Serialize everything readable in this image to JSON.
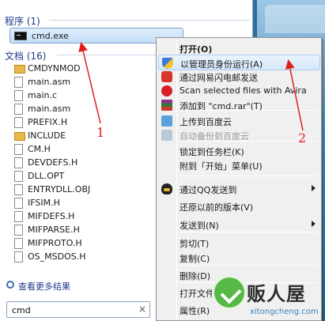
{
  "start_menu": {
    "programs_header": "程序 (1)",
    "program_item": "cmd.exe",
    "documents_header": "文档 (16)",
    "documents": [
      {
        "name": "CMDYNMOD",
        "type": "folder"
      },
      {
        "name": "main.asm",
        "type": "file"
      },
      {
        "name": "main.c",
        "type": "file"
      },
      {
        "name": "main.asm",
        "type": "file"
      },
      {
        "name": "PREFIX.H",
        "type": "file"
      },
      {
        "name": "INCLUDE",
        "type": "folder"
      },
      {
        "name": "CM.H",
        "type": "file"
      },
      {
        "name": "DEVDEFS.H",
        "type": "file"
      },
      {
        "name": "DLL.OPT",
        "type": "file"
      },
      {
        "name": "ENTRYDLL.OBJ",
        "type": "file"
      },
      {
        "name": "IFSIM.H",
        "type": "file"
      },
      {
        "name": "MIFDEFS.H",
        "type": "file"
      },
      {
        "name": "MIFPARSE.H",
        "type": "file"
      },
      {
        "name": "MIFPROTO.H",
        "type": "file"
      },
      {
        "name": "OS_MSDOS.H",
        "type": "file"
      }
    ],
    "see_more": "查看更多结果",
    "search_value": "cmd",
    "search_clear": "×"
  },
  "context_menu": {
    "items": [
      {
        "label": "打开(O)",
        "bold": true,
        "icon": ""
      },
      {
        "label": "以管理员身份运行(A)",
        "icon": "uac-shield-icon",
        "highlight": true
      },
      {
        "label": "通过网易闪电邮发送",
        "icon": "netease-mail-icon"
      },
      {
        "label": "Scan selected files with Avira",
        "icon": "avira-icon"
      },
      {
        "label": "添加到 \"cmd.rar\"(T)",
        "icon": "winrar-icon"
      },
      {
        "label": "上传到百度云",
        "icon": "baidu-cloud-icon"
      },
      {
        "label": "自动备份到百度云",
        "icon": "baidu-cloud-disabled-icon",
        "disabled": true
      },
      {
        "label": "锁定到任务栏(K)"
      },
      {
        "label": "附到「开始」菜单(U)"
      },
      {
        "label": "通过QQ发送到",
        "icon": "qq-icon",
        "submenu": true
      },
      {
        "label": "还原以前的版本(V)"
      },
      {
        "label": "发送到(N)",
        "submenu": true
      },
      {
        "label": "剪切(T)"
      },
      {
        "label": "复制(C)"
      },
      {
        "label": "删除(D)"
      },
      {
        "label": "打开文件位置(I)"
      },
      {
        "label": "属性(R)"
      }
    ]
  },
  "annotations": {
    "label_1": "1",
    "label_2": "2",
    "color": "#e21d1d"
  },
  "watermark": {
    "text": "贩人屋",
    "url": "xitongcheng.com"
  }
}
